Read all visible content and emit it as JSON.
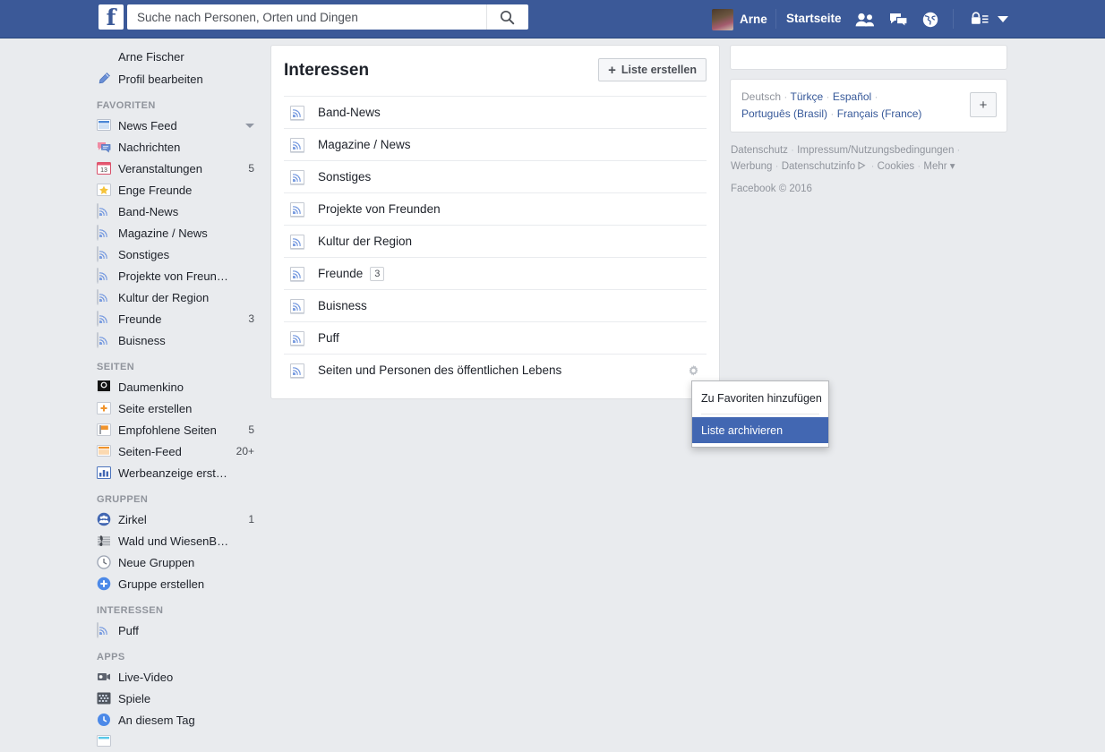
{
  "topbar": {
    "logo": "f",
    "search": {
      "placeholder": "Suche nach Personen, Orten und Dingen",
      "value": "",
      "icon": "search-icon"
    },
    "user_name": "Arne",
    "home_label": "Startseite",
    "icons": [
      "friend-requests-icon",
      "messages-icon",
      "notifications-globe-icon",
      "privacy-lock-icon",
      "account-chevron-down-icon"
    ],
    "brand_color": "#3b5998"
  },
  "sidebar": {
    "profile": {
      "name": "Arne Fischer",
      "icon": "avatar"
    },
    "edit_profile": {
      "label": "Profil bearbeiten",
      "icon": "pencil-icon"
    },
    "sections": [
      {
        "title": "FAVORITEN",
        "items": [
          {
            "label": "News Feed",
            "icon": "news-feed-icon",
            "count": "",
            "caret": true
          },
          {
            "label": "Nachrichten",
            "icon": "messages-icon",
            "count": ""
          },
          {
            "label": "Veranstaltungen",
            "icon": "calendar-13-icon",
            "count": "5"
          },
          {
            "label": "Enge Freunde",
            "icon": "star-icon",
            "count": ""
          },
          {
            "label": "Band-News",
            "icon": "rss-icon",
            "count": ""
          },
          {
            "label": "Magazine / News",
            "icon": "rss-icon",
            "count": ""
          },
          {
            "label": "Sonstiges",
            "icon": "rss-icon",
            "count": ""
          },
          {
            "label": "Projekte von Freun…",
            "icon": "rss-icon",
            "count": ""
          },
          {
            "label": "Kultur der Region",
            "icon": "rss-icon",
            "count": ""
          },
          {
            "label": "Freunde",
            "icon": "rss-icon",
            "count": "3"
          },
          {
            "label": "Buisness",
            "icon": "rss-icon",
            "count": ""
          }
        ]
      },
      {
        "title": "SEITEN",
        "items": [
          {
            "label": "Daumenkino",
            "icon": "page-logo-icon",
            "count": ""
          },
          {
            "label": "Seite erstellen",
            "icon": "plus-box-icon",
            "count": ""
          },
          {
            "label": "Empfohlene Seiten",
            "icon": "flag-icon",
            "count": "5"
          },
          {
            "label": "Seiten-Feed",
            "icon": "pages-feed-icon",
            "count": "20+"
          },
          {
            "label": "Werbeanzeige erst…",
            "icon": "bar-chart-icon",
            "count": ""
          }
        ]
      },
      {
        "title": "GRUPPEN",
        "items": [
          {
            "label": "Zirkel",
            "icon": "group-icon",
            "count": "1"
          },
          {
            "label": "Wald und WiesenB…",
            "icon": "music-note-icon",
            "count": ""
          },
          {
            "label": "Neue Gruppen",
            "icon": "clock-icon",
            "count": ""
          },
          {
            "label": "Gruppe erstellen",
            "icon": "plus-circle-icon",
            "count": ""
          }
        ]
      },
      {
        "title": "INTERESSEN",
        "items": [
          {
            "label": "Puff",
            "icon": "rss-icon",
            "count": ""
          }
        ]
      },
      {
        "title": "APPS",
        "items": [
          {
            "label": "Live-Video",
            "icon": "video-camera-icon",
            "count": ""
          },
          {
            "label": "Spiele",
            "icon": "games-icon",
            "count": ""
          },
          {
            "label": "An diesem Tag",
            "icon": "on-this-day-icon",
            "count": ""
          }
        ]
      }
    ]
  },
  "main": {
    "title": "Interessen",
    "create_button": {
      "label": "Liste erstellen",
      "plus": "+"
    },
    "rows": [
      {
        "label": "Band-News",
        "icon": "rss-icon",
        "badge": ""
      },
      {
        "label": "Magazine / News",
        "icon": "rss-icon",
        "badge": ""
      },
      {
        "label": "Sonstiges",
        "icon": "rss-icon",
        "badge": ""
      },
      {
        "label": "Projekte von Freunden",
        "icon": "rss-icon",
        "badge": ""
      },
      {
        "label": "Kultur der Region",
        "icon": "rss-icon",
        "badge": ""
      },
      {
        "label": "Freunde",
        "icon": "rss-icon",
        "badge": "3"
      },
      {
        "label": "Buisness",
        "icon": "rss-icon",
        "badge": ""
      },
      {
        "label": "Puff",
        "icon": "rss-icon",
        "badge": ""
      },
      {
        "label": "Seiten und Personen des öffentlichen Lebens",
        "icon": "rss-icon",
        "badge": ""
      }
    ],
    "gear": "gear-icon"
  },
  "context_menu": {
    "items": [
      {
        "label": "Zu Favoriten hinzufügen",
        "selected": false
      },
      {
        "label": "Liste archivieren",
        "selected": true
      }
    ],
    "highlight_color": "#4267b2"
  },
  "right": {
    "languages": {
      "current": "Deutsch",
      "others": [
        "Türkçe",
        "Español",
        "Português (Brasil)",
        "Français (France)"
      ],
      "add_label": "+"
    },
    "footer_links": [
      "Datenschutz",
      "Impressum/Nutzungsbedingungen",
      "Werbung",
      "Datenschutzinfo",
      "Cookies",
      "Mehr"
    ],
    "copyright": "Facebook © 2016"
  }
}
